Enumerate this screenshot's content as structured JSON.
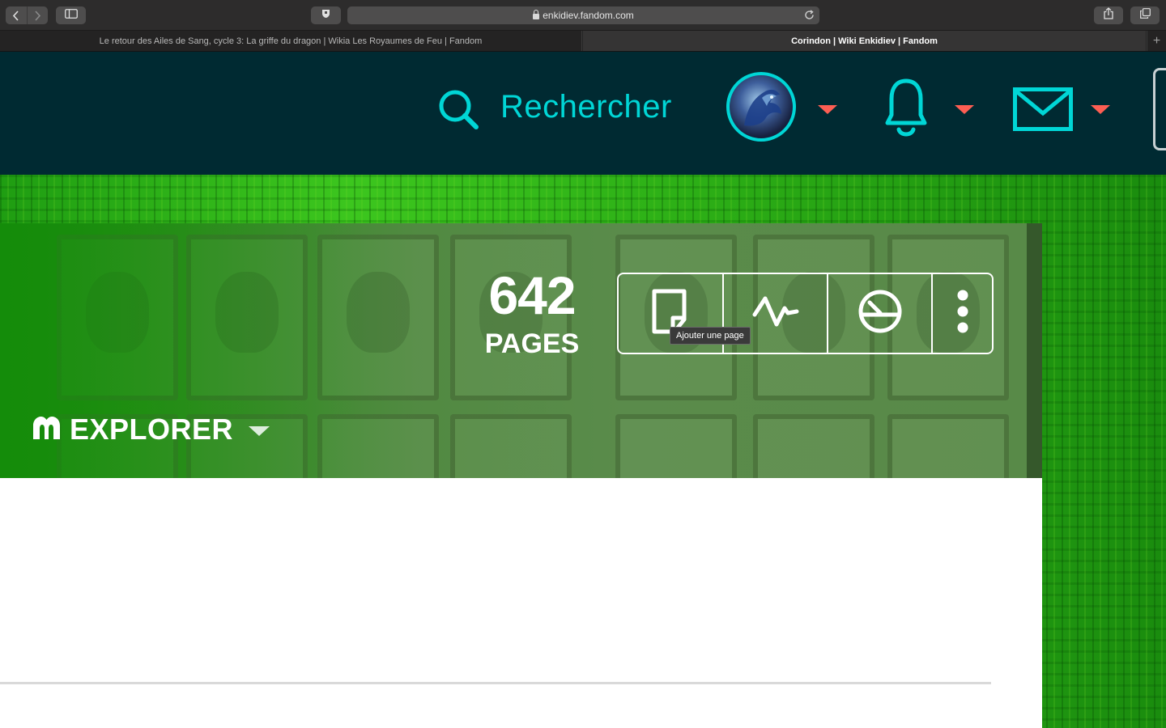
{
  "browser": {
    "url": "enkidiev.fandom.com",
    "tabs": [
      {
        "title": "Le retour des Ailes de Sang, cycle 3: La griffe du dragon | Wikia Les Royaumes de Feu | Fandom",
        "active": false
      },
      {
        "title": "Corindon | Wiki Enkidiev | Fandom",
        "active": true
      }
    ],
    "new_tab_label": "+"
  },
  "header": {
    "search_label": "Rechercher",
    "accent_color": "#00d6d6",
    "caret_color": "#fd5e53",
    "background": "#002a32"
  },
  "wiki": {
    "page_count": "642",
    "page_count_label": "PAGES",
    "actions": [
      {
        "name": "add-page",
        "icon": "page-icon"
      },
      {
        "name": "recent-activity",
        "icon": "activity-icon"
      },
      {
        "name": "insights",
        "icon": "gauge-icon"
      },
      {
        "name": "more",
        "icon": "kebab-icon"
      }
    ],
    "tooltip": "Ajouter une page",
    "explorer_label": "EXPLORER"
  }
}
